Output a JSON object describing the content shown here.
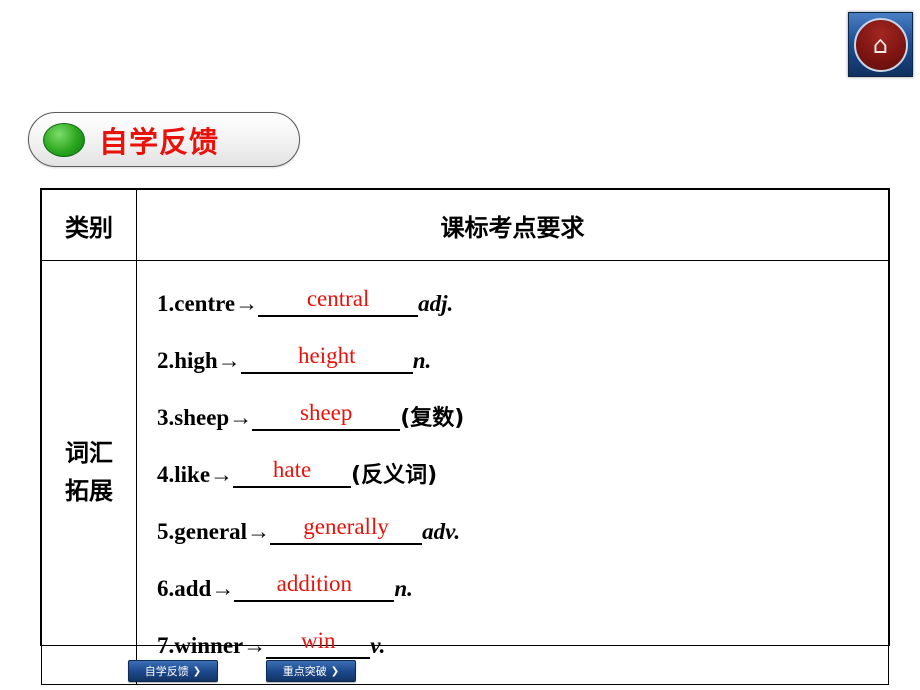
{
  "home_button": {
    "icon": "home-icon",
    "glyph": "⌂"
  },
  "section_title": {
    "text": "自学反馈"
  },
  "table": {
    "headers": {
      "category": "类别",
      "requirement": "课标考点要求"
    },
    "category_label": "词汇拓展",
    "category_lines": [
      "词汇",
      "拓展"
    ],
    "items": [
      {
        "num": "1.",
        "word": "centre",
        "arrow": "→",
        "answer": "central",
        "suffix": "adj.",
        "suffix_type": "pos"
      },
      {
        "num": "2.",
        "word": "high",
        "arrow": "→",
        "answer": "height",
        "suffix": "n.",
        "suffix_type": "pos"
      },
      {
        "num": "3.",
        "word": "sheep",
        "arrow": "→",
        "answer": "sheep",
        "suffix": "(复数)",
        "suffix_type": "cn"
      },
      {
        "num": "4.",
        "word": "like",
        "arrow": "→",
        "answer": "hate",
        "suffix": "(反义词)",
        "suffix_type": "cn"
      },
      {
        "num": "5.",
        "word": "general",
        "arrow": "→",
        "answer": "generally",
        "suffix": "adv.",
        "suffix_type": "pos"
      },
      {
        "num": "6.",
        "word": "add",
        "arrow": "→",
        "answer": "addition",
        "suffix": "n.",
        "suffix_type": "pos"
      },
      {
        "num": "7.",
        "word": "winner",
        "arrow": "→",
        "answer": "win",
        "suffix": "v.",
        "suffix_type": "pos"
      }
    ]
  },
  "bottom_nav": [
    {
      "label": "自学反馈",
      "chevron": "❯"
    },
    {
      "label": "重点突破",
      "chevron": "❯"
    }
  ],
  "colors": {
    "answer_red": "#e8120a",
    "title_red": "#e8120a",
    "nav_blue": "#1d4a8f",
    "bullet_green": "#2aa61f"
  }
}
